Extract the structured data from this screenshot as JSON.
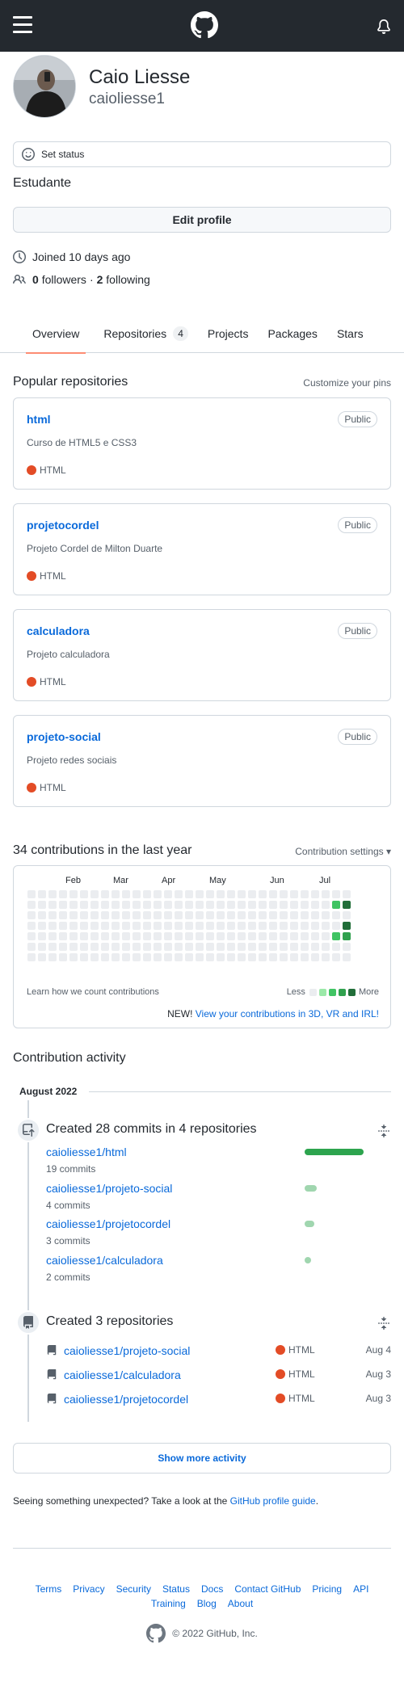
{
  "header": {
    "menu_icon": "hamburger-icon",
    "logo_icon": "github-mark-icon",
    "bell_icon": "bell-icon"
  },
  "profile": {
    "name": "Caio Liesse",
    "login": "caioliesse1",
    "set_status": "Set status",
    "bio": "Estudante",
    "edit_profile": "Edit profile",
    "joined": "Joined 10 days ago",
    "followers_count": "0",
    "followers_label": "followers",
    "separator": "·",
    "following_count": "2",
    "following_label": "following"
  },
  "tabs": [
    {
      "label": "Overview",
      "active": true
    },
    {
      "label": "Repositories",
      "count": "4"
    },
    {
      "label": "Projects"
    },
    {
      "label": "Packages"
    },
    {
      "label": "Stars"
    }
  ],
  "popular": {
    "title": "Popular repositories",
    "customize": "Customize your pins",
    "repos": [
      {
        "name": "html",
        "visibility": "Public",
        "description": "Curso de HTML5 e CSS3",
        "language": "HTML"
      },
      {
        "name": "projetocordel",
        "visibility": "Public",
        "description": "Projeto Cordel de Milton Duarte",
        "language": "HTML"
      },
      {
        "name": "calculadora",
        "visibility": "Public",
        "description": "Projeto calculadora",
        "language": "HTML"
      },
      {
        "name": "projeto-social",
        "visibility": "Public",
        "description": "Projeto redes sociais",
        "language": "HTML"
      }
    ],
    "language_color": "#e34c26"
  },
  "contributions": {
    "title": "34 contributions in the last year",
    "settings": "Contribution settings ▾",
    "months": [
      "Feb",
      "Mar",
      "Apr",
      "May",
      "Jun",
      "Jul"
    ],
    "learn": "Learn how we count contributions",
    "less": "Less",
    "more": "More",
    "new_prefix": "NEW!",
    "new_link": "View your contributions in 3D, VR and IRL!",
    "level_colors": [
      "#ebedf0",
      "#9be9a8",
      "#40c463",
      "#30a14e",
      "#216e39"
    ],
    "last_weeks_levels": [
      [
        0,
        0,
        0,
        0,
        0,
        0,
        0
      ],
      [
        0,
        2,
        0,
        0,
        2,
        0,
        0
      ],
      [
        0,
        4,
        0,
        4,
        3,
        0,
        0
      ]
    ]
  },
  "activity": {
    "title": "Contribution activity",
    "month": "August 2022",
    "commits": {
      "title": "Created 28 commits in 4 repositories",
      "items": [
        {
          "repo": "caioliesse1/html",
          "count": "19 commits",
          "value": 19
        },
        {
          "repo": "caioliesse1/projeto-social",
          "count": "4 commits",
          "value": 4
        },
        {
          "repo": "caioliesse1/projetocordel",
          "count": "3 commits",
          "value": 3
        },
        {
          "repo": "caioliesse1/calculadora",
          "count": "2 commits",
          "value": 2
        }
      ]
    },
    "created": {
      "title": "Created 3 repositories",
      "items": [
        {
          "repo": "caioliesse1/projeto-social",
          "language": "HTML",
          "date": "Aug 4"
        },
        {
          "repo": "caioliesse1/calculadora",
          "language": "HTML",
          "date": "Aug 3"
        },
        {
          "repo": "caioliesse1/projetocordel",
          "language": "HTML",
          "date": "Aug 3"
        }
      ]
    },
    "show_more": "Show more activity",
    "unexpected_prefix": "Seeing something unexpected? Take a look at the",
    "unexpected_link": "GitHub profile guide",
    "unexpected_suffix": "."
  },
  "footer": {
    "links": [
      "Terms",
      "Privacy",
      "Security",
      "Status",
      "Docs",
      "Contact GitHub",
      "Pricing",
      "API",
      "Training",
      "Blog",
      "About"
    ],
    "copyright": "© 2022 GitHub, Inc."
  }
}
